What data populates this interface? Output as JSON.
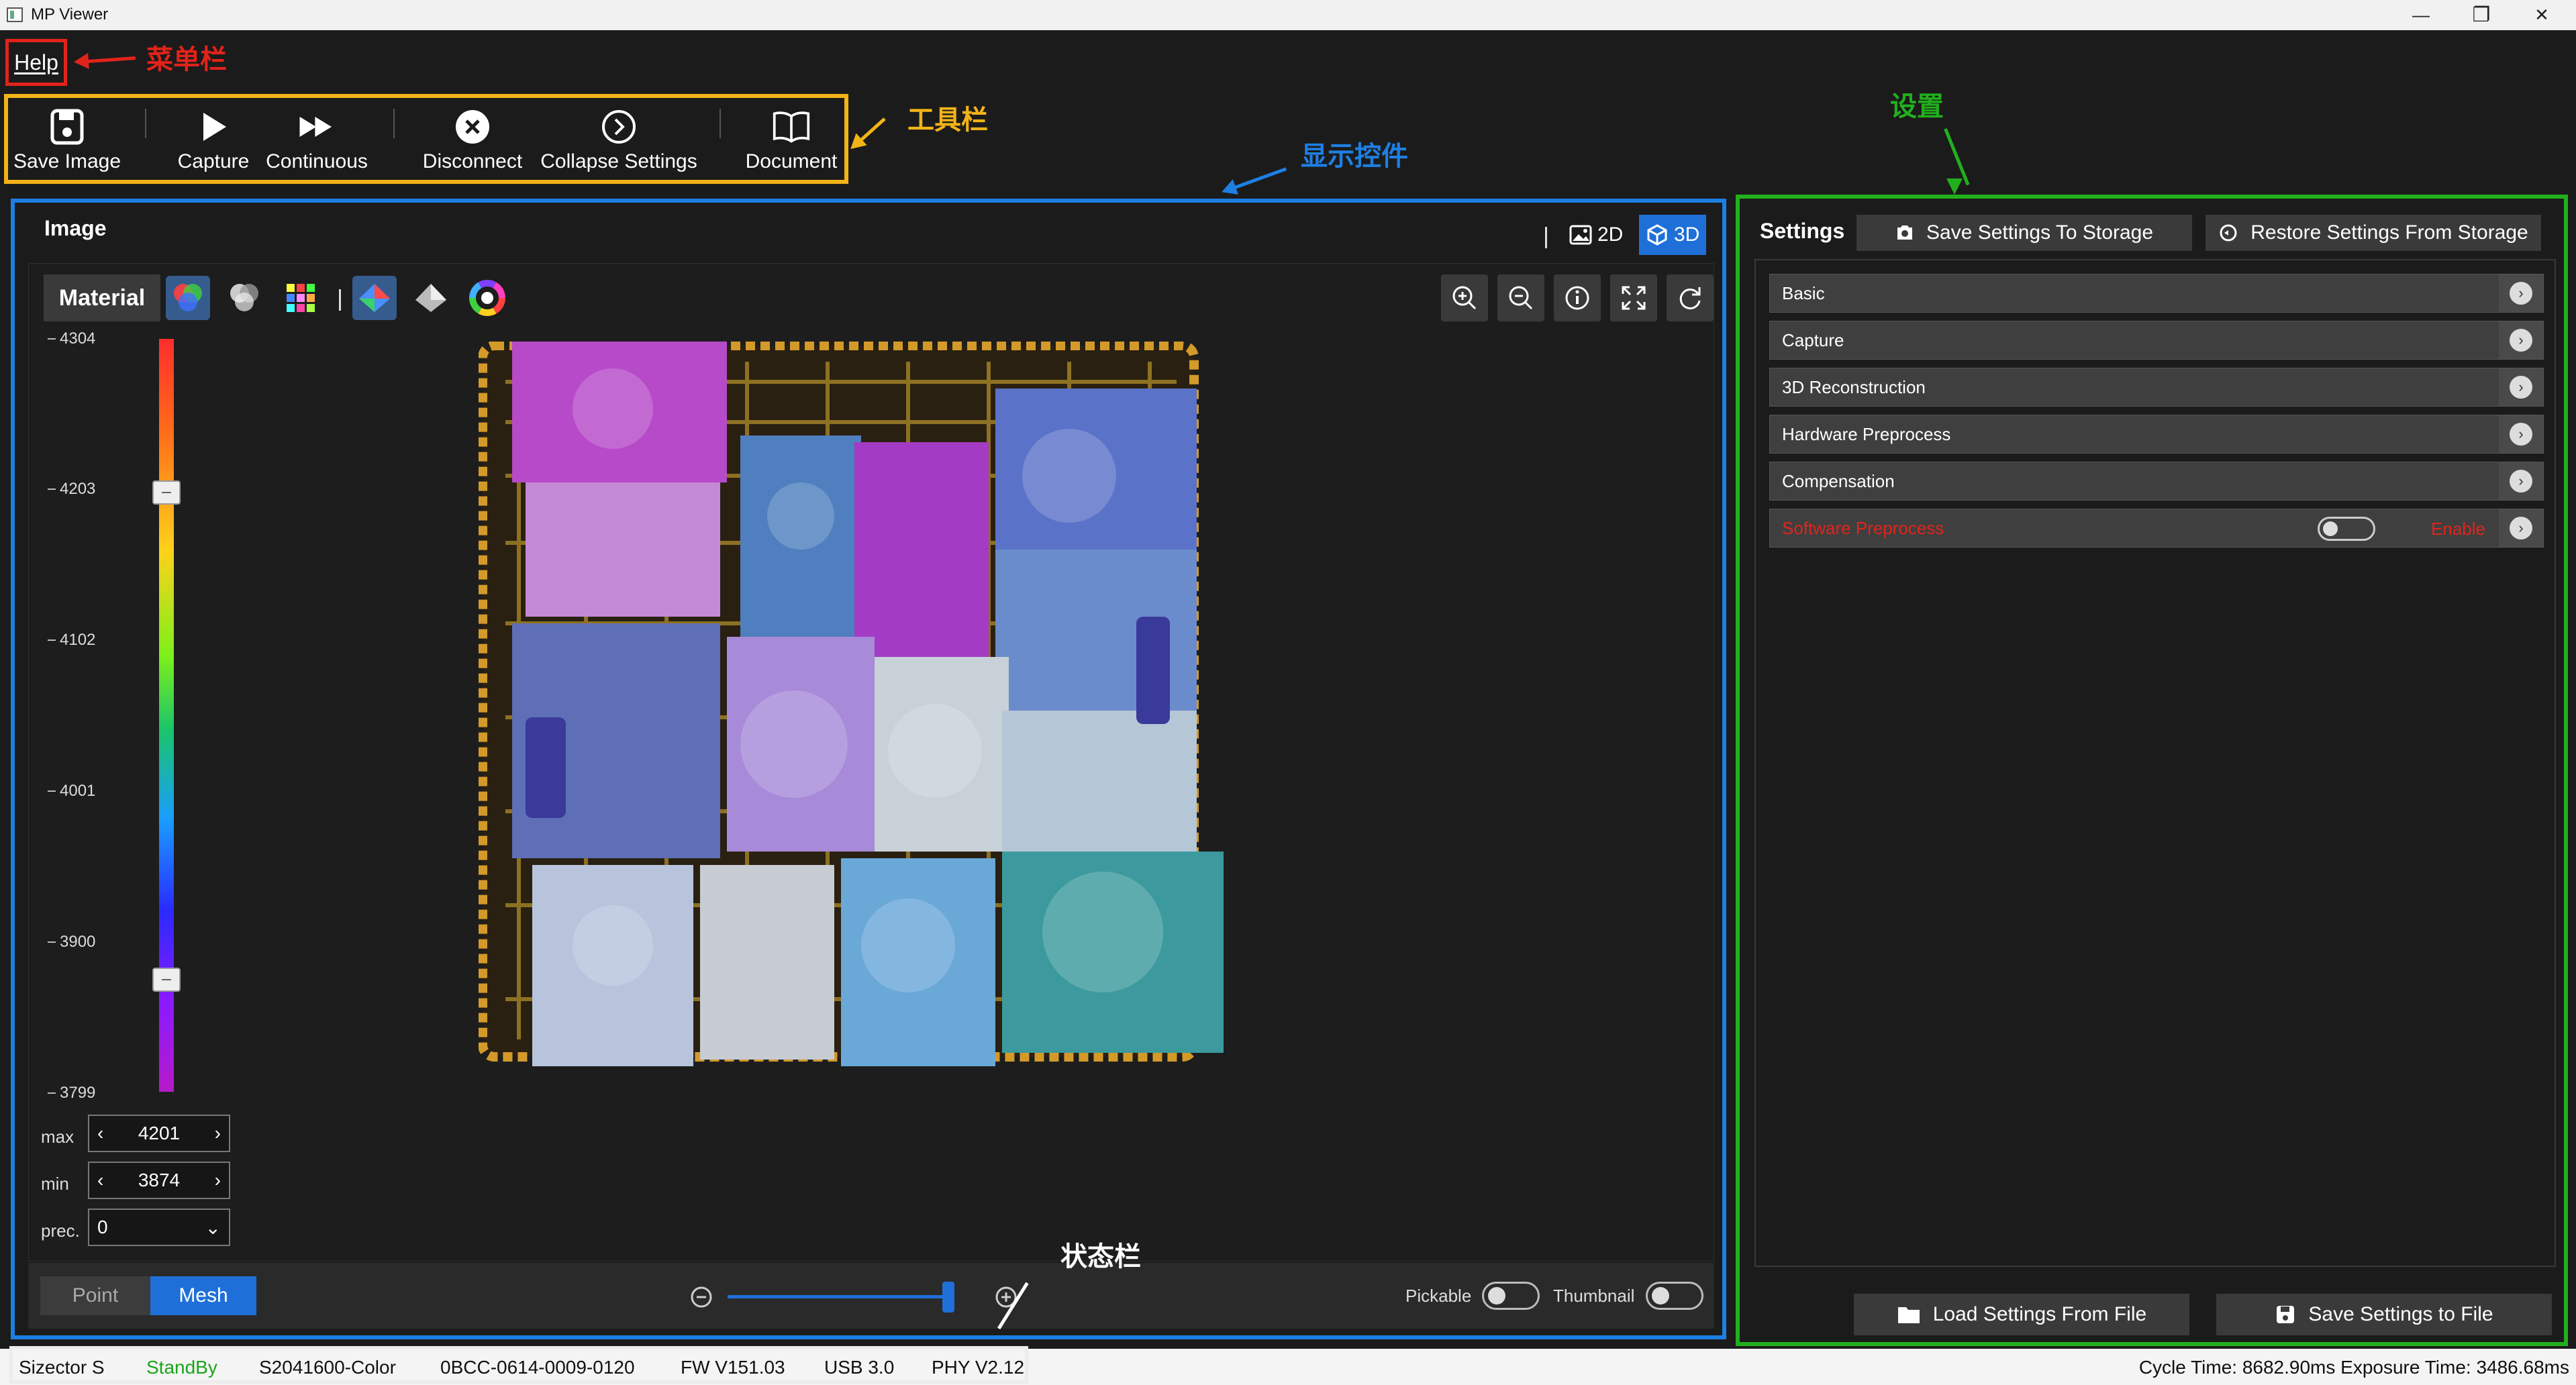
{
  "window": {
    "title": "MP Viewer",
    "minimize": "—",
    "maximize": "❐",
    "close": "✕"
  },
  "menu": {
    "help": "Help"
  },
  "annotations": {
    "menu_bar": "菜单栏",
    "toolbar": "工具栏",
    "display_control": "显示控件",
    "settings": "设置",
    "status_bar": "状态栏"
  },
  "toolbar": {
    "save_image": "Save Image",
    "capture": "Capture",
    "continuous": "Continuous",
    "disconnect": "Disconnect",
    "collapse_settings": "Collapse Settings",
    "document": "Document"
  },
  "display": {
    "title": "Image",
    "mode_2d": "2D",
    "mode_3d": "3D",
    "active_mode": "3D",
    "material_label": "Material",
    "colorbar_ticks": [
      "4304",
      "4203",
      "4102",
      "4001",
      "3900",
      "3799"
    ],
    "range_handles": {
      "upper": 4201,
      "lower": 3874
    },
    "max_label": "max",
    "max_value": "4201",
    "min_label": "min",
    "min_value": "3874",
    "prec_label": "prec.",
    "prec_value": "0",
    "render_point": "Point",
    "render_mesh": "Mesh",
    "active_render": "Mesh",
    "pickable_label": "Pickable",
    "thumbnail_label": "Thumbnail",
    "pickable_on": false,
    "thumbnail_on": false
  },
  "settings": {
    "tab": "Settings",
    "save_to_storage": "Save Settings To Storage",
    "restore_from_storage": "Restore Settings From Storage",
    "sections": [
      {
        "label": "Basic"
      },
      {
        "label": "Capture"
      },
      {
        "label": "3D Reconstruction"
      },
      {
        "label": "Hardware Preprocess"
      },
      {
        "label": "Compensation"
      },
      {
        "label": "Software Preprocess",
        "toggle_label": "Enable"
      }
    ],
    "load_from_file": "Load Settings From File",
    "save_to_file": "Save Settings to File"
  },
  "status": {
    "device": "Sizector S",
    "state": "StandBy",
    "model": "S2041600-Color",
    "serial": "0BCC-0614-0009-0120",
    "fw": "FW V151.03",
    "usb": "USB 3.0",
    "phy": "PHY V2.12",
    "timing": "Cycle Time: 8682.90ms Exposure Time: 3486.68ms"
  },
  "colors": {
    "menu_frame": "#e2231a",
    "toolbar_frame": "#f2b318",
    "display_frame": "#1e7fe3",
    "settings_frame": "#21b01d",
    "accent": "#1f6fd8",
    "state_standby": "#1aa51a",
    "software_preprocess": "#e0241c"
  }
}
